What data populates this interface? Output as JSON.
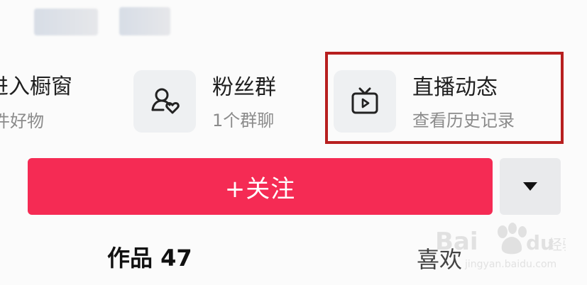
{
  "header": {
    "blurred": true
  },
  "features": {
    "showcase": {
      "title": "进入橱窗",
      "subtitle": "件好物",
      "icon": "shop-icon"
    },
    "fans_group": {
      "title": "粉丝群",
      "subtitle": "1个群聊",
      "icon": "user-heart-icon"
    },
    "live_moments": {
      "title": "直播动态",
      "subtitle": "查看历史记录",
      "icon": "tv-play-icon"
    }
  },
  "actions": {
    "follow_label": "+关注",
    "dropdown_icon": "caret-down-icon"
  },
  "tabs": {
    "works_label": "作品",
    "works_count": "47",
    "likes_label": "喜欢"
  },
  "watermark": {
    "brand": "Baidu经验",
    "url": "jingyan.baidu.com"
  },
  "colors": {
    "follow_button": "#f52b54",
    "highlight_box": "#b71f1f",
    "tile_background": "#eef0f2"
  }
}
